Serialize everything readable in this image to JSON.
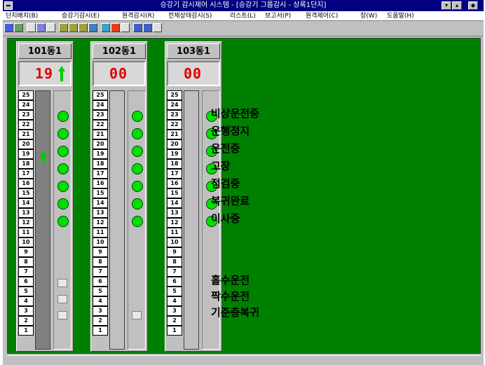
{
  "window": {
    "title": "승강기 감시제어 시스템 - [승강기 그룹감시 - 상록1단지]"
  },
  "menu": [
    "단지배치(B)",
    "승강기감시(E)",
    "원격감시(R)",
    "전체상태감시(S)",
    "리스트(L)",
    "보고서(P)",
    "원격제어(C)",
    "창(W)",
    "도움말(H)"
  ],
  "colors": {
    "panel_bg": "#008000",
    "floor_indicator": "#e00000",
    "lamp_on": "#00e000",
    "arrow": "#00cc00"
  },
  "elevators": [
    {
      "name": "101동1",
      "floor_display": "19",
      "direction": "up",
      "car_floor": "19",
      "car_direction_icon": "up-arrow-icon"
    },
    {
      "name": "102동1",
      "floor_display": "00",
      "direction": "none"
    },
    {
      "name": "103동1",
      "floor_display": "00",
      "direction": "none"
    }
  ],
  "floors": [
    "25",
    "24",
    "23",
    "22",
    "21",
    "20",
    "19",
    "18",
    "17",
    "16",
    "15",
    "14",
    "13",
    "12",
    "11",
    "10",
    "9",
    "8",
    "7",
    "6",
    "5",
    "4",
    "3",
    "2",
    "1"
  ],
  "status_legend": [
    "비상운전중",
    "운행정지",
    "운전중",
    "고장",
    "점검중",
    "복귀완료",
    "이사중"
  ],
  "mode_legend": [
    "홀수운전",
    "짝수운전",
    "기준층복귀"
  ]
}
